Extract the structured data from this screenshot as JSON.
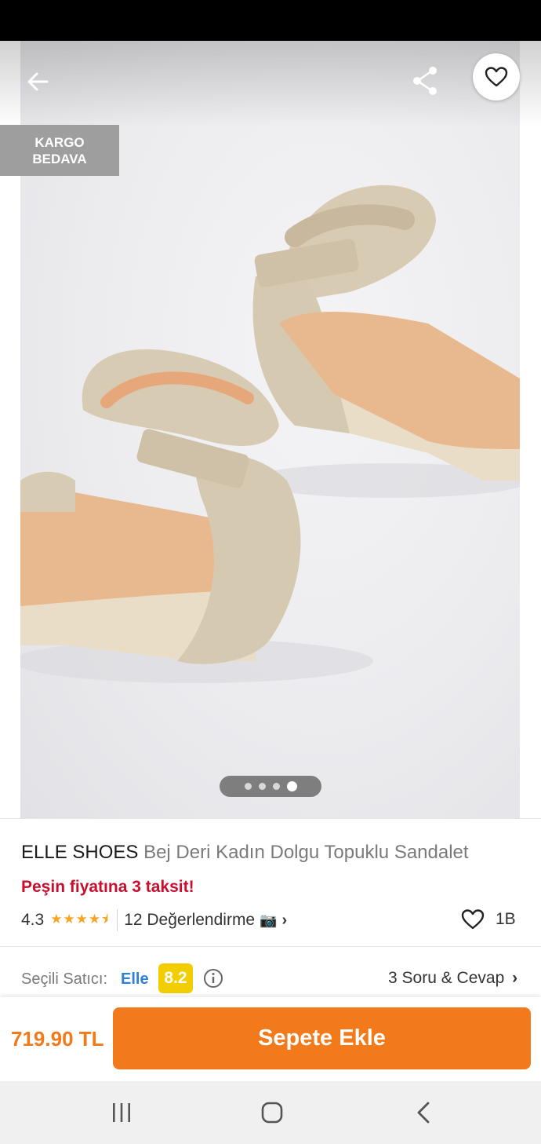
{
  "icons": {
    "back": "arrow-left",
    "share": "share",
    "favorite": "heart-outline",
    "like": "heart-outline",
    "camera": "camera",
    "info": "info-circle",
    "nav_recents": "recent-apps",
    "nav_home": "home",
    "nav_back": "back-chevron"
  },
  "gallery": {
    "badge_line1": "KARGO",
    "badge_line2": "BEDAVA",
    "total_images": 4,
    "active_image_index": 4
  },
  "product": {
    "brand": "ELLE SHOES",
    "name": "Bej Deri Kadın Dolgu Topuklu Sandalet",
    "installment_text": "Peşin fiyatına 3 taksit!"
  },
  "rating": {
    "score": "4.3",
    "stars_value": 4.3,
    "stars_glyphs": "★★★★⯨",
    "review_text": "12 Değerlendirme",
    "camera_glyph": "📷",
    "chevron": "›"
  },
  "likes": {
    "count": "1B"
  },
  "seller": {
    "label": "Seçili Satıcı:",
    "name": "Elle",
    "score": "8.2",
    "qa_text": "3 Soru & Cevap",
    "qa_chevron": "›"
  },
  "bottom_bar": {
    "price": "719.90 TL",
    "add_to_cart_label": "Sepete Ekle"
  },
  "colors": {
    "accent": "#f27a1a",
    "installment_red": "#c8102e",
    "seller_blue": "#2f80d8",
    "score_yellow": "#f2cd00",
    "star": "#f5a623"
  }
}
